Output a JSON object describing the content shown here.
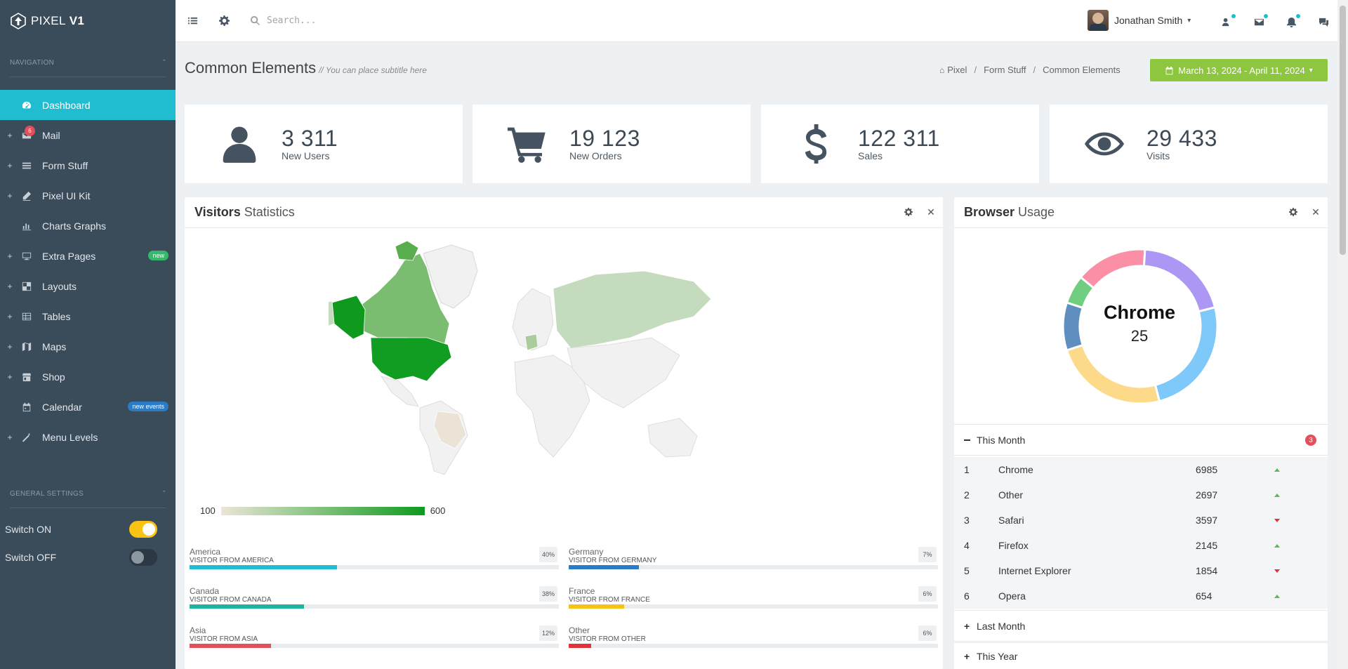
{
  "sidebar": {
    "logo_text": "PIXEL",
    "logo_bold": "V1",
    "nav_header": "Navigation",
    "items": [
      {
        "label": "Dashboard"
      },
      {
        "label": "Mail",
        "badge": "6"
      },
      {
        "label": "Form Stuff"
      },
      {
        "label": "Pixel UI Kit"
      },
      {
        "label": "Charts  Graphs"
      },
      {
        "label": "Extra Pages",
        "pill": "new"
      },
      {
        "label": "Layouts"
      },
      {
        "label": "Tables"
      },
      {
        "label": "Maps"
      },
      {
        "label": "Shop"
      },
      {
        "label": "Calendar",
        "pill": "new events"
      },
      {
        "label": "Menu Levels"
      }
    ],
    "general_header": "General Settings",
    "switch_on_label": "Switch ON",
    "switch_off_label": "Switch OFF"
  },
  "topbar": {
    "search_placeholder": "Search...",
    "user_name": "Jonathan Smith"
  },
  "page": {
    "title": "Common Elements",
    "subtitle": "// You can place subtitle here",
    "breadcrumb": [
      "Pixel",
      "Form Stuff",
      "Common Elements"
    ],
    "date_range": "March 13, 2024 - April 11, 2024"
  },
  "stats": [
    {
      "value": "3 311",
      "label": "New Users",
      "icon": "user-icon"
    },
    {
      "value": "19 123",
      "label": "New Orders",
      "icon": "cart-icon"
    },
    {
      "value": "122 311",
      "label": "Sales",
      "icon": "dollar-icon"
    },
    {
      "value": "29 433",
      "label": "Visits",
      "icon": "eye-icon"
    }
  ],
  "visitors_panel": {
    "title_bold": "Visitors",
    "title_light": "Statistics",
    "legend_min": "100",
    "legend_max": "600",
    "bars": [
      {
        "name": "America",
        "sub": "Visitor from America",
        "pct_label": "40%",
        "pct": 40,
        "color": "#20bdd0"
      },
      {
        "name": "Canada",
        "sub": "Visitor from Canada",
        "pct_label": "38%",
        "pct": 31,
        "color": "#1fb4a0"
      },
      {
        "name": "Asia",
        "sub": "Visitor from Asia",
        "pct_label": "12%",
        "pct": 22,
        "color": "#e4505a"
      },
      {
        "name": "Germany",
        "sub": "Visitor from Germany",
        "pct_label": "7%",
        "pct": 19,
        "color": "#2b7bc7"
      },
      {
        "name": "France",
        "sub": "Visitor from France",
        "pct_label": "6%",
        "pct": 15,
        "color": "#f4c313"
      },
      {
        "name": "Other",
        "sub": "Visitor from Other",
        "pct_label": "6%",
        "pct": 6,
        "color": "#e4323a"
      }
    ]
  },
  "browser_panel": {
    "title_bold": "Browser",
    "title_light": "Usage",
    "center_name": "Chrome",
    "center_value": "25",
    "this_month": "This Month",
    "this_month_count": "3",
    "last_month": "Last Month",
    "this_year": "This Year",
    "rows": [
      {
        "rank": "1",
        "name": "Chrome",
        "value": "6985",
        "trend": "up"
      },
      {
        "rank": "2",
        "name": "Other",
        "value": "2697",
        "trend": "up"
      },
      {
        "rank": "3",
        "name": "Safari",
        "value": "3597",
        "trend": "down"
      },
      {
        "rank": "4",
        "name": "Firefox",
        "value": "2145",
        "trend": "up"
      },
      {
        "rank": "5",
        "name": "Internet Explorer",
        "value": "1854",
        "trend": "down"
      },
      {
        "rank": "6",
        "name": "Opera",
        "value": "654",
        "trend": "up"
      }
    ],
    "donut_segments": [
      {
        "value": 25,
        "color": "#7ec8fa"
      },
      {
        "value": 24,
        "color": "#fdd98a"
      },
      {
        "value": 10,
        "color": "#5e8fbf"
      },
      {
        "value": 6,
        "color": "#6fce7f"
      },
      {
        "value": 15,
        "color": "#fb8fa6"
      },
      {
        "value": 20,
        "color": "#ad97f4"
      }
    ]
  },
  "colors": {
    "accent": "#20bdd0",
    "sidebar": "#3a4b59",
    "date_button": "#8dc63f"
  }
}
